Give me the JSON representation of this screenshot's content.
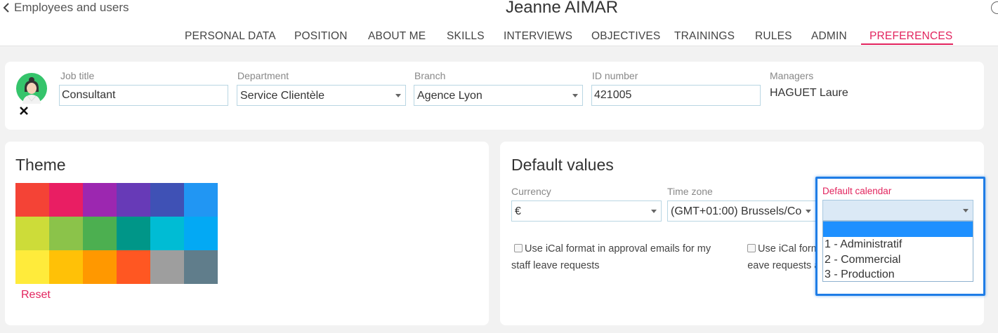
{
  "header": {
    "back_label": "Employees and users",
    "user_name": "Jeanne AIMAR"
  },
  "tabs": [
    {
      "label": "PERSONAL DATA",
      "active": false
    },
    {
      "label": "POSITION",
      "active": false
    },
    {
      "label": "ABOUT ME",
      "active": false
    },
    {
      "label": "SKILLS",
      "active": false
    },
    {
      "label": "INTERVIEWS",
      "active": false
    },
    {
      "label": "OBJECTIVES",
      "active": false
    },
    {
      "label": "TRAININGS",
      "active": false
    },
    {
      "label": "RULES",
      "active": false
    },
    {
      "label": "ADMIN",
      "active": false
    },
    {
      "label": "PREFERENCES",
      "active": true
    }
  ],
  "profile": {
    "job_title_label": "Job title",
    "job_title_value": "Consultant",
    "department_label": "Department",
    "department_value": "Service Clientèle",
    "branch_label": "Branch",
    "branch_value": "Agence Lyon",
    "id_label": "ID number",
    "id_value": "421005",
    "managers_label": "Managers",
    "managers_value": "HAGUET Laure"
  },
  "theme": {
    "title": "Theme",
    "reset_label": "Reset",
    "swatches": [
      "#f44336",
      "#e91e63",
      "#9c27b0",
      "#673ab7",
      "#3f51b5",
      "#2196f3",
      "#cddc39",
      "#8bc34a",
      "#4caf50",
      "#009688",
      "#00bcd4",
      "#03a9f4",
      "#ffeb3b",
      "#ffc107",
      "#ff9800",
      "#ff5722",
      "#9e9e9e",
      "#607d8b"
    ]
  },
  "defaults": {
    "title": "Default values",
    "currency_label": "Currency",
    "currency_value": "€",
    "timezone_label": "Time zone",
    "timezone_value": "(GMT+01:00) Brussels/Co",
    "calendar_label": "Default calendar",
    "calendar_value": "",
    "calendar_options": [
      "",
      "1 - Administratif",
      "2 - Commercial",
      "3 - Production"
    ],
    "ical_staff_line1": "Use iCal format in approval emails for my",
    "ical_staff_line2": "staff leave requests",
    "ical_own_line1": "Use iCal form",
    "ical_own_line2": "leave requests",
    "ical_own_fragment": "a"
  },
  "colors": {
    "accent": "#e2245e",
    "highlight": "#1f7de6",
    "dropdown_selected": "#1e90ff"
  }
}
